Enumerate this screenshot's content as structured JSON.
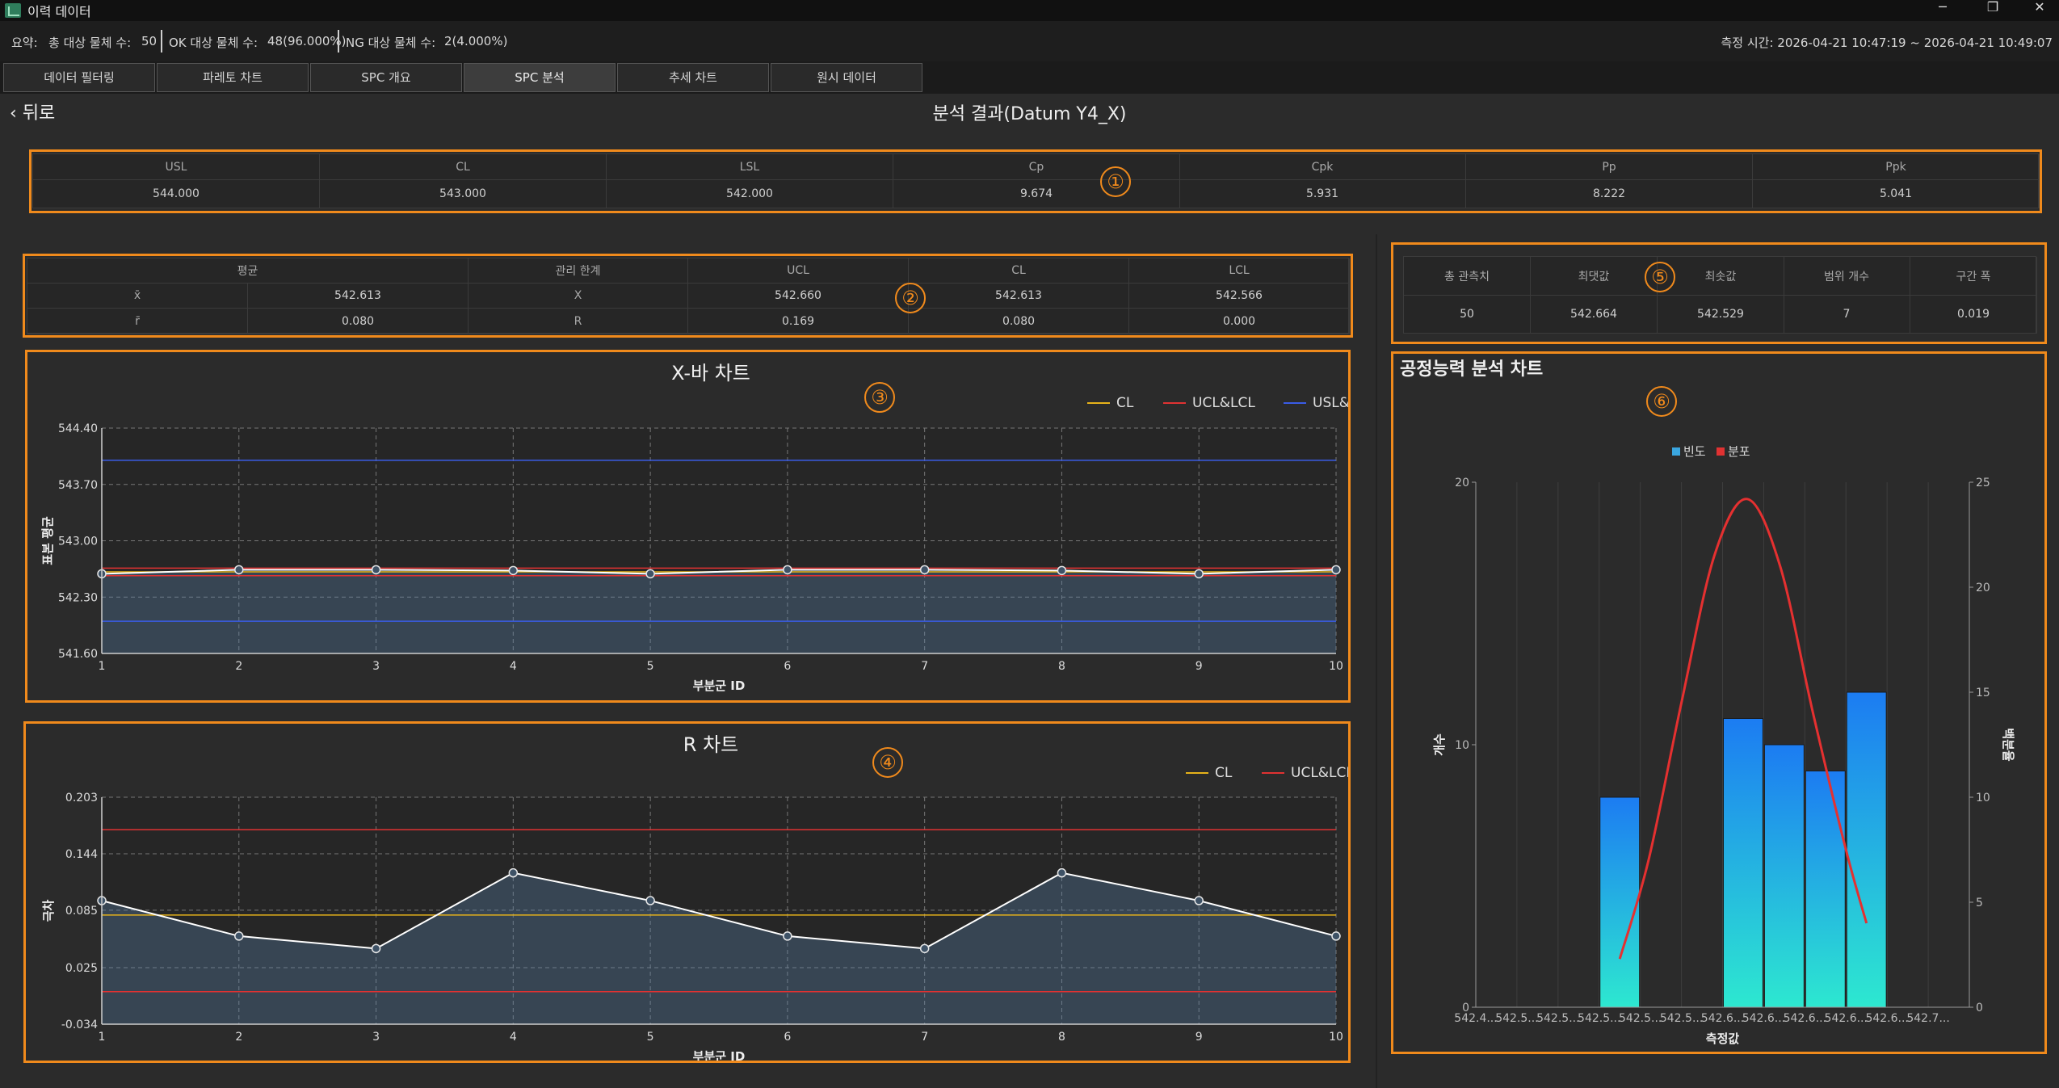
{
  "window": {
    "title": "이력 데이터",
    "minimize": "─",
    "maximize": "❐",
    "close": "✕"
  },
  "summary": {
    "prefix": "요약:",
    "total_label": "총 대상 물체 수:",
    "total_value": "50",
    "ok_label": "OK 대상 물체 수:",
    "ok_value": "48(96.000%)",
    "ng_label": "NG 대상 물체 수:",
    "ng_value": "2(4.000%)",
    "time": "측정 시간: 2026-04-21 10:47:19 ~ 2026-04-21 10:49:07"
  },
  "tabs": [
    "데이터 필터링",
    "파레토 차트",
    "SPC 개요",
    "SPC 분석",
    "추세 차트",
    "원시 데이터"
  ],
  "active_tab": "SPC 분석",
  "back_label": "뒤로",
  "heading": "분석 결과(Datum Y4_X)",
  "markers": [
    "①",
    "②",
    "③",
    "④",
    "⑤",
    "⑥"
  ],
  "capability": {
    "headers": [
      "USL",
      "CL",
      "LSL",
      "Cp",
      "Cpk",
      "Pp",
      "Ppk"
    ],
    "values": [
      "544.000",
      "543.000",
      "542.000",
      "9.674",
      "5.931",
      "8.222",
      "5.041"
    ]
  },
  "control": {
    "h_mean": "평균",
    "h_limit": "관리 한계",
    "h_ucl": "UCL",
    "h_cl": "CL",
    "h_lcl": "LCL",
    "rows": [
      {
        "sym": "x̄",
        "mean": "542.613",
        "name": "X",
        "ucl": "542.660",
        "cl": "542.613",
        "lcl": "542.566"
      },
      {
        "sym": "r̄",
        "mean": "0.080",
        "name": "R",
        "ucl": "0.169",
        "cl": "0.080",
        "lcl": "0.000"
      }
    ]
  },
  "stats": {
    "headers": [
      "총 관측치",
      "최댓값",
      "최솟값",
      "범위 개수",
      "구간 폭"
    ],
    "values": [
      "50",
      "542.664",
      "542.529",
      "7",
      "0.019"
    ]
  },
  "colors": {
    "accent": "#f08a1c",
    "cl": "#e6b21a",
    "ucl": "#e03232",
    "usl": "#3a5ce6",
    "line": "#ffffff"
  },
  "chart_data": [
    {
      "type": "line",
      "title": "X-바 차트",
      "xlabel": "부분군 ID",
      "ylabel": "표본 평균",
      "x": [
        1,
        2,
        3,
        4,
        5,
        6,
        7,
        8,
        9,
        10
      ],
      "xlim": [
        1,
        10
      ],
      "ylim": [
        541.6,
        544.4
      ],
      "yticks": [
        "541.60",
        "542.30",
        "543.00",
        "543.70",
        "544.40"
      ],
      "series": [
        {
          "name": "",
          "values": [
            542.59,
            542.64,
            542.64,
            542.63,
            542.59,
            542.64,
            542.64,
            542.63,
            542.59,
            542.64
          ]
        }
      ],
      "legend": [
        "CL",
        "UCL&LCL",
        "USL&LSL"
      ],
      "lines": {
        "cl": 542.613,
        "ucl": 542.66,
        "lcl": 542.566,
        "usl": 544.0,
        "lsl": 542.0
      },
      "legend_position": "top-right",
      "grid": true
    },
    {
      "type": "line",
      "title": "R 차트",
      "xlabel": "부분군 ID",
      "ylabel": "극차",
      "x": [
        1,
        2,
        3,
        4,
        5,
        6,
        7,
        8,
        9,
        10
      ],
      "xlim": [
        1,
        10
      ],
      "ylim": [
        -0.034,
        0.203
      ],
      "yticks": [
        "-0.034",
        "0.025",
        "0.085",
        "0.144",
        "0.203"
      ],
      "series": [
        {
          "name": "",
          "values": [
            0.095,
            0.058,
            0.045,
            0.124,
            0.095,
            0.058,
            0.045,
            0.124,
            0.095,
            0.058
          ]
        }
      ],
      "legend": [
        "CL",
        "UCL&LCL"
      ],
      "lines": {
        "cl": 0.08,
        "ucl": 0.169,
        "lcl": 0.0
      },
      "legend_position": "top-right",
      "grid": true
    },
    {
      "type": "bar",
      "title": "공정능력 분석 차트",
      "xlabel": "측정값",
      "ylabel": "개수",
      "y2label": "백분율",
      "legend": [
        "빈도",
        "분포"
      ],
      "legend_position": "top-center",
      "xticks": [
        "542.4...",
        "542.5...",
        "542.5...",
        "542.5...",
        "542.5...",
        "542.5...",
        "542.6...",
        "542.6...",
        "542.6...",
        "542.6...",
        "542.6...",
        "542.7..."
      ],
      "ylim": [
        0,
        20
      ],
      "yticks": [
        "0",
        "10",
        "20"
      ],
      "y2lim": [
        0,
        25
      ],
      "y2ticks": [
        "0",
        "5",
        "10",
        "15",
        "20",
        "25"
      ],
      "bars": [
        {
          "bin": 3,
          "value": 8
        },
        {
          "bin": 6,
          "value": 11
        },
        {
          "bin": 7,
          "value": 10
        },
        {
          "bin": 8,
          "value": 9
        },
        {
          "bin": 9,
          "value": 12
        }
      ],
      "curve": {
        "x": [
          3.5,
          4.2,
          5.0,
          5.8,
          6.6,
          7.4,
          8.2,
          9.0,
          9.5
        ],
        "y": [
          2.3,
          7.0,
          14.5,
          21.5,
          24.2,
          21.0,
          14.0,
          7.5,
          4.0
        ]
      },
      "grid": true
    }
  ]
}
